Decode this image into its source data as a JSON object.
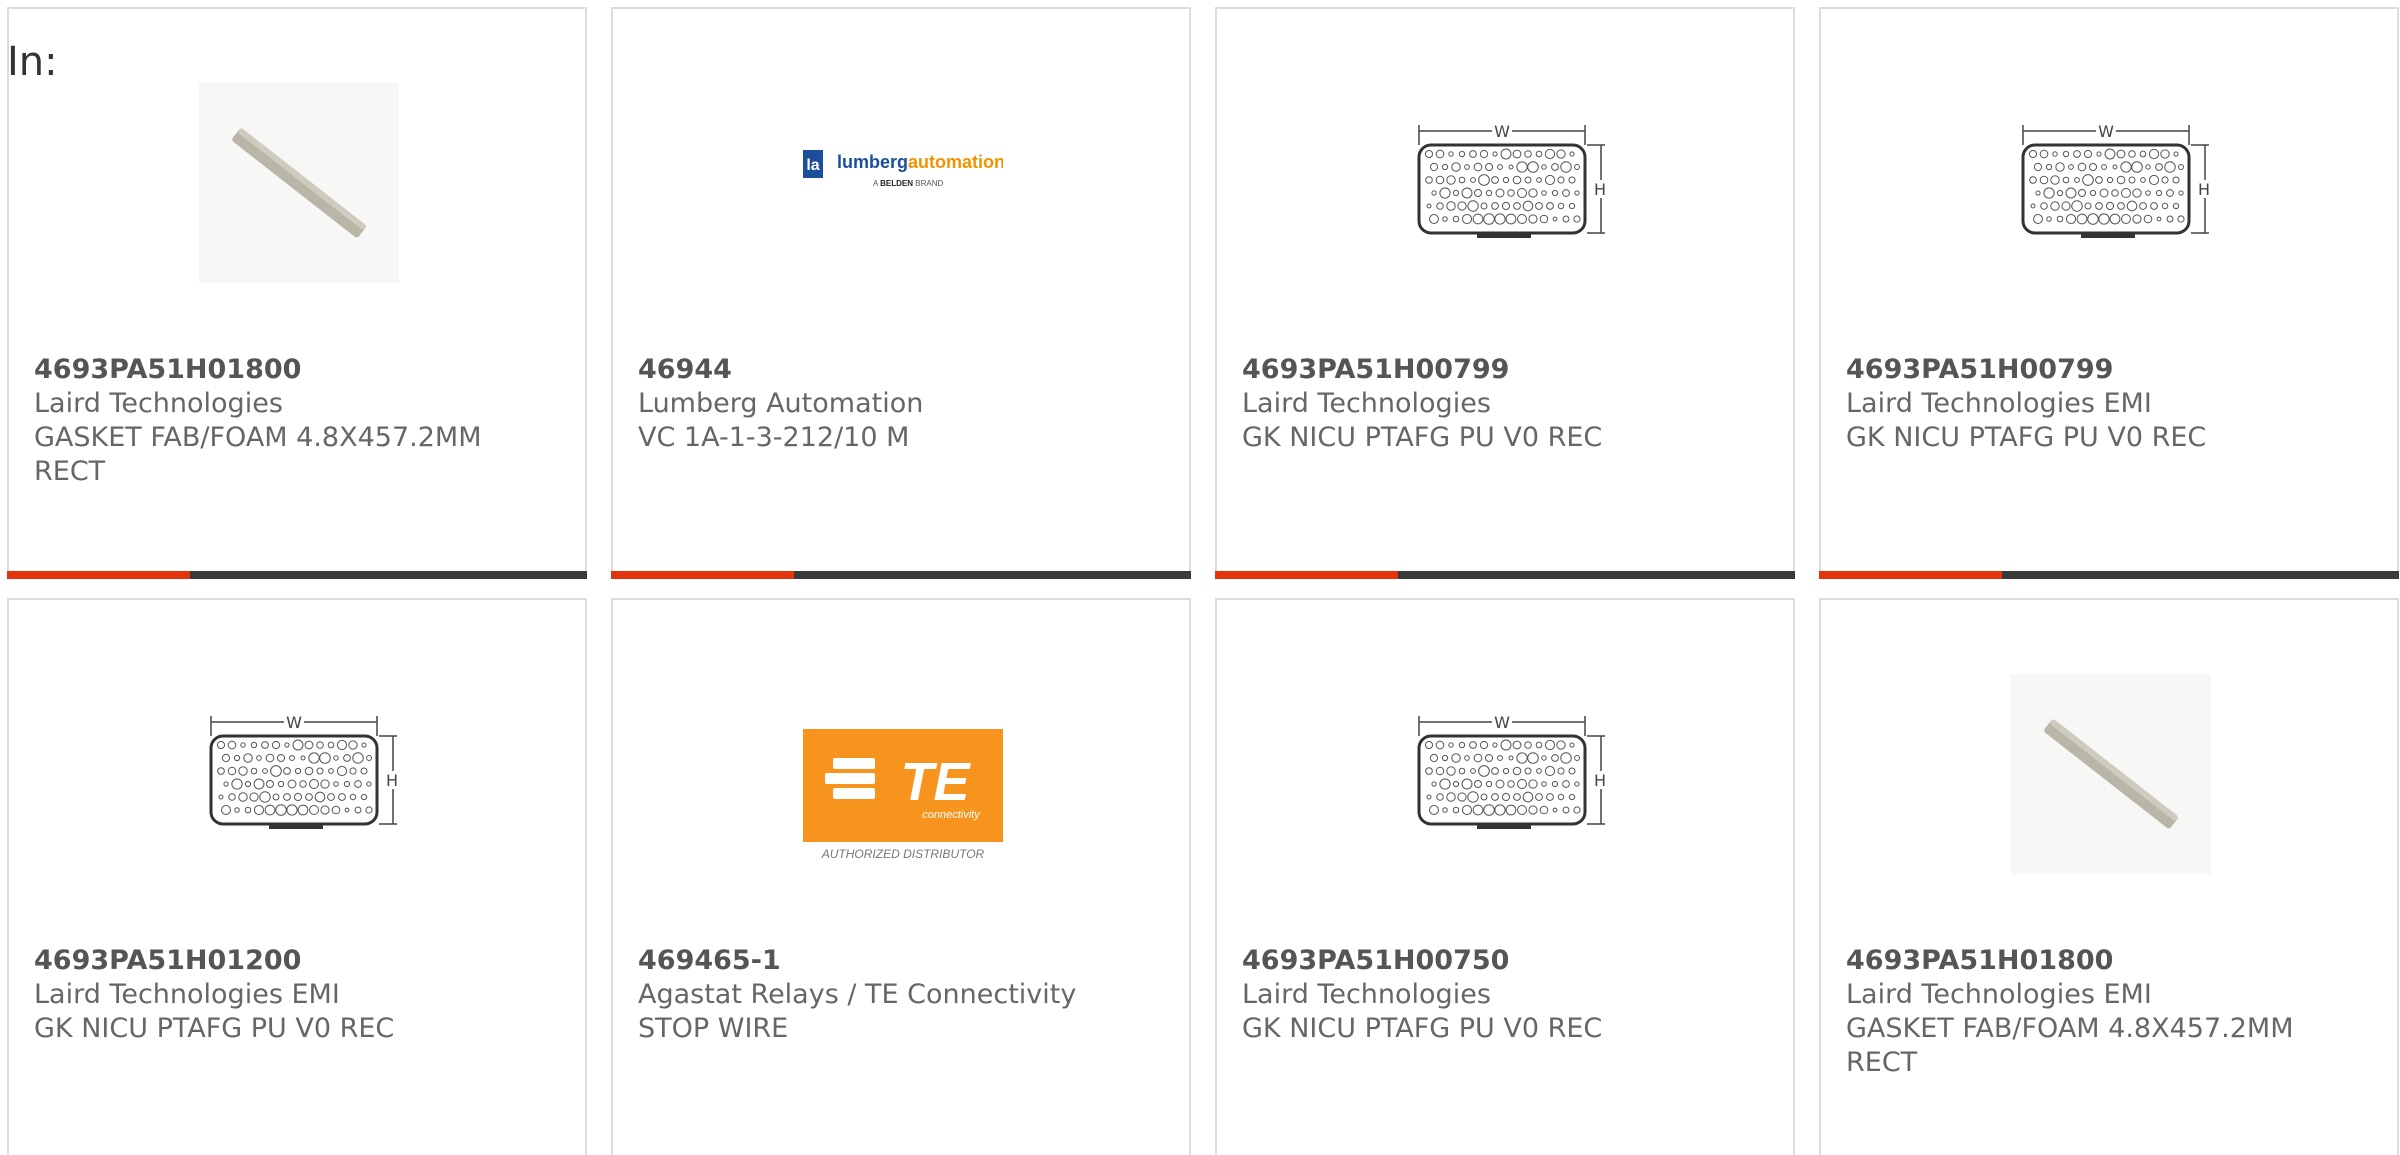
{
  "header": {
    "label": "In:"
  },
  "cards": [
    {
      "part_number": "4693PA51H01800",
      "manufacturer": "Laird Technologies",
      "description": "GASKET FAB/FOAM 4.8X457.2MM RECT",
      "image": "gasket-strip-image"
    },
    {
      "part_number": "46944",
      "manufacturer": "Lumberg Automation",
      "description": "VC 1A-1-3-212/10 M",
      "image": "lumberg-automation-logo",
      "logo": {
        "mark": "la",
        "brand_a": "lumberg",
        "brand_b": "automation",
        "tagline_pre": "A",
        "tagline_bold": "BELDEN",
        "tagline_post": "BRAND"
      }
    },
    {
      "part_number": "4693PA51H00799",
      "manufacturer": "Laird Technologies",
      "description": "GK NICU PTAFG PU V0 REC",
      "image": "gasket-profile-diagram"
    },
    {
      "part_number": "4693PA51H00799",
      "manufacturer": "Laird Technologies EMI",
      "description": "GK NICU PTAFG PU V0 REC",
      "image": "gasket-profile-diagram"
    },
    {
      "part_number": "4693PA51H01200",
      "manufacturer": "Laird Technologies EMI",
      "description": "GK NICU PTAFG PU V0 REC",
      "image": "gasket-profile-diagram"
    },
    {
      "part_number": "469465-1",
      "manufacturer": "Agastat Relays / TE Connectivity",
      "description": "STOP WIRE",
      "image": "te-connectivity-logo",
      "logo": {
        "main": "TE",
        "sub": "connectivity",
        "caption": "AUTHORIZED DISTRIBUTOR"
      }
    },
    {
      "part_number": "4693PA51H00750",
      "manufacturer": "Laird Technologies",
      "description": "GK NICU PTAFG PU V0 REC",
      "image": "gasket-profile-diagram"
    },
    {
      "part_number": "4693PA51H01800",
      "manufacturer": "Laird Technologies EMI",
      "description": "GASKET FAB/FOAM 4.8X457.2MM RECT",
      "image": "gasket-strip-image"
    }
  ],
  "diagram": {
    "width_label": "W",
    "height_label": "H"
  },
  "colors": {
    "accent": "#e2350e",
    "bar": "#3a3a3a",
    "border": "#dcdcdc",
    "te_orange": "#f7941d",
    "lumberg_blue": "#1b4f9c",
    "lumberg_orange": "#f39200"
  }
}
